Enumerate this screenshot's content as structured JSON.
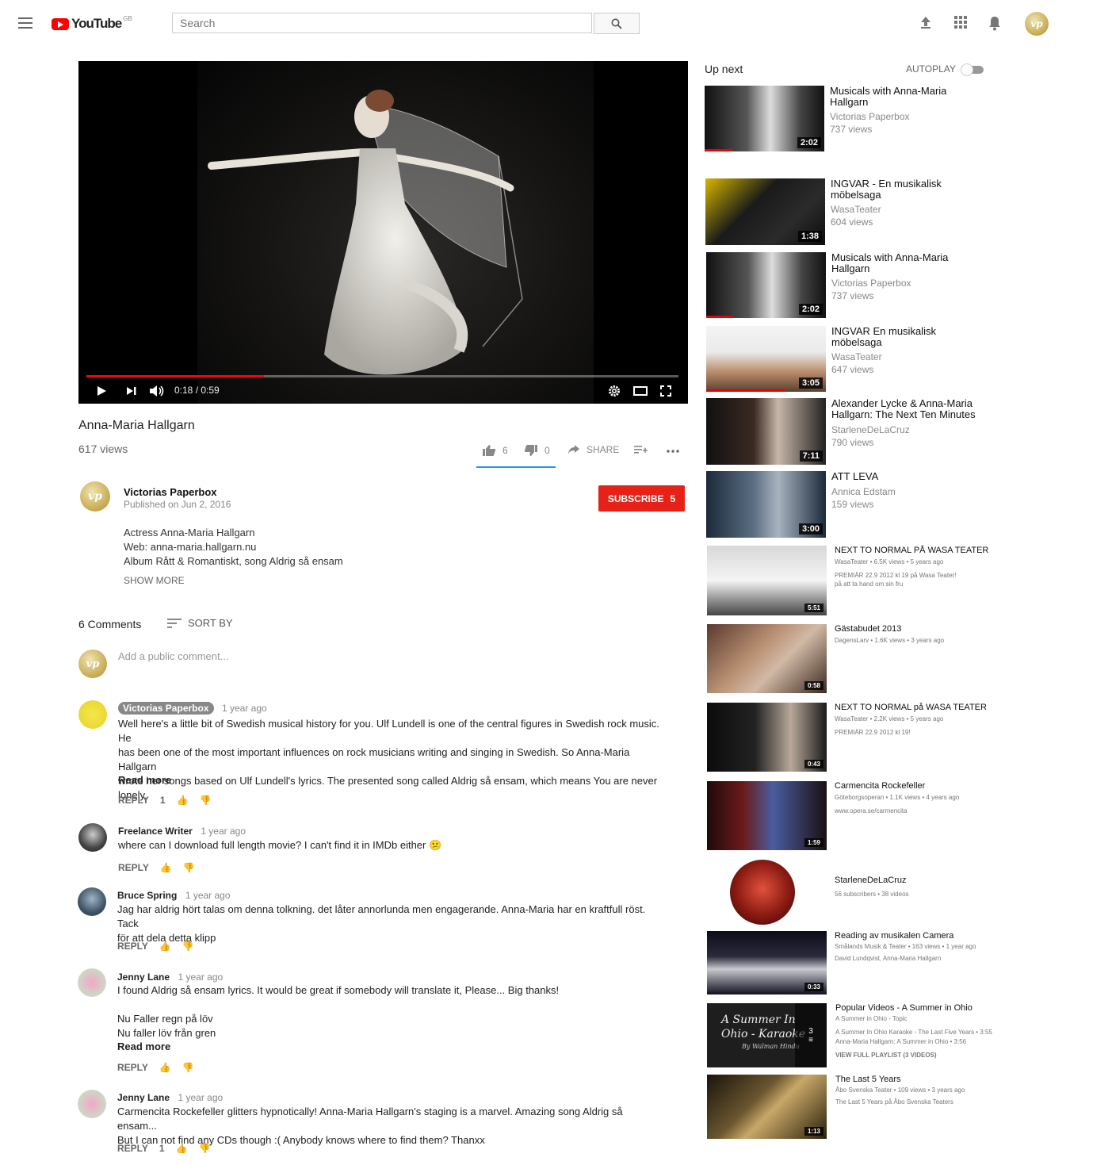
{
  "header": {
    "logo_text": "YouTube",
    "region": "GB",
    "search_placeholder": "Search",
    "avatar_initials": "vp"
  },
  "player": {
    "timecode": "0:18 / 0:59",
    "progress": 0.3,
    "buffered": 0.3
  },
  "video": {
    "title": "Anna-Maria Hallgarn",
    "views": "617 views",
    "likes": "6",
    "dislikes": "0",
    "share_label": "SHARE"
  },
  "channel": {
    "name": "Victorias Paperbox",
    "published": "Published on Jun 2, 2016",
    "subscribe_label": "SUBSCRIBE",
    "subscriber_count": "5",
    "description": [
      "Actress Anna-Maria Hallgarn",
      "Web: anna-maria.hallgarn.nu",
      "Album Rått & Romantiskt, song Aldrig så ensam"
    ],
    "show_more": "SHOW MORE"
  },
  "comments": {
    "count_label": "6 Comments",
    "sort_label": "SORT BY",
    "add_placeholder": "Add a public comment...",
    "reply_label": "REPLY",
    "read_more": "Read more",
    "items": [
      {
        "author": "Victorias Paperbox",
        "time": "1 year ago",
        "lines": [
          "Well here's a little bit of Swedish musical history for you. Ulf Lundell is one of the central figures in Swedish rock music. He",
          "has been one of the most important influences on rock musicians writing and singing in Swedish. So Anna-Maria Hallgarn",
          "wrote her songs based on Ulf Lundell's lyrics. The presented song called  Aldrig så ensam, which means You are never",
          "lonely."
        ],
        "likes": "1"
      },
      {
        "author": "Freelance Writer",
        "time": "1 year ago",
        "lines": [
          "where can I download full length movie? I can't find it in IMDb either 😕"
        ],
        "likes": ""
      },
      {
        "author": "Bruce Spring",
        "time": "1 year ago",
        "lines": [
          "Jag har aldrig hört talas om denna tolkning. det låter annorlunda men engagerande. Anna-Maria har en kraftfull röst. Tack",
          "för att dela detta klipp"
        ],
        "likes": ""
      },
      {
        "author": "Jenny Lane",
        "time": "1 year ago",
        "lines": [
          "I found Aldrig så ensam lyrics. It would be great if somebody will translate it, Please... Big thanks!",
          "",
          "Nu Faller regn på löv",
          "Nu faller löv från gren"
        ],
        "likes": ""
      },
      {
        "author": "Jenny Lane",
        "time": "1 year ago",
        "lines": [
          "Carmencita Rockefeller glitters hypnotically! Anna-Maria Hallgarn's staging is a marvel. Amazing song Aldrig så ensam...",
          "But I can not find any CDs though :( Anybody knows where to find them? Thanxx"
        ],
        "likes": "1"
      }
    ]
  },
  "sidebar": {
    "up_next": "Up next",
    "autoplay": "AUTOPLAY",
    "videos": [
      {
        "title": "Musicals with Anna-Maria Hallgarn",
        "channel": "Victorias Paperbox",
        "views": "737 views",
        "duration": "2:02"
      },
      {
        "title": "INGVAR - En musikalisk möbelsaga",
        "channel": "WasaTeater",
        "views": "604 views",
        "duration": "1:38"
      },
      {
        "title": "Musicals with Anna-Maria Hallgarn",
        "channel": "Victorias Paperbox",
        "views": "737 views",
        "duration": "2:02"
      },
      {
        "title": "INGVAR En musikalisk möbelsaga",
        "channel": "WasaTeater",
        "views": "647 views",
        "duration": "3:05"
      },
      {
        "title": "Alexander Lycke & Anna-Maria Hallgarn: The Next Ten Minutes",
        "channel": "StarleneDeLaCruz",
        "views": "790 views",
        "duration": "7:11"
      },
      {
        "title": "ATT LEVA",
        "channel": "Annica Edstam",
        "views": "159 views",
        "duration": "3:00"
      }
    ],
    "small_videos": [
      {
        "title": "NEXT TO NORMAL PÅ WASA TEATER",
        "meta": "WasaTeater • 6.5K views • 5 years ago",
        "desc": "PREMIÄR 22.9 2012 kl 19 på Wasa Teater! på att ta hand om sin fru",
        "duration": "5:51"
      },
      {
        "title": "Gästabudet 2013",
        "meta": "DagensLarv • 1.6K views • 3 years ago",
        "desc": "",
        "duration": "0:58"
      },
      {
        "title": "NEXT TO NORMAL på WASA TEATER",
        "meta": "WasaTeater • 2.2K views • 5 years ago",
        "desc": "PREMIÄR 22.9 2012 kl 19!",
        "duration": "0:43"
      },
      {
        "title": "Carmencita Rockefeller",
        "meta": "Göteborgsoperan • 1.1K views • 4 years ago",
        "desc": "www.opera.se/carmencita",
        "duration": "1:59"
      }
    ],
    "channel_card": {
      "name": "StarleneDeLaCruz",
      "meta": "56 subscribers • 38 videos"
    },
    "more_videos": [
      {
        "title": "Reading av musikalen Camera",
        "meta": "Smålands Musik & Teater • 163 views • 1 year ago",
        "desc": "David Lundqvist, Anna-Maria Hallgarn",
        "duration": "0:33"
      },
      {
        "title": "Popular Videos - A Summer in Ohio",
        "meta": "A Summer in Ohio - Topic",
        "desc": "A Summer In Ohio Karaoke - The Last Five Years • 3:55",
        "desc2": "Anna-Maria Hallgarn: A Summer in Ohio • 3:56",
        "desc3": "VIEW FULL PLAYLIST (3 VIDEOS)",
        "thumb_text": "A Summer In Ohio - Karaoke",
        "thumb_sub": "By Walman Hindu",
        "playlist_count": "3"
      },
      {
        "title": "The Last 5 Years",
        "meta": "Åbo Svenska Teater • 109 views • 3 years ago",
        "desc": "The Last 5 Years på Åbo Svenska Teaters",
        "duration": "1:13"
      }
    ]
  }
}
